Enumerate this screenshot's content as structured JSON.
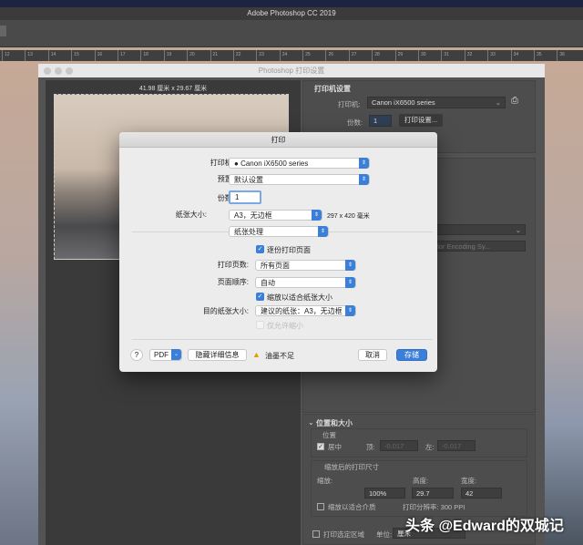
{
  "app": {
    "title": "Adobe Photoshop CC 2019"
  },
  "ruler": [
    "12",
    "13",
    "14",
    "15",
    "16",
    "17",
    "18",
    "19",
    "20",
    "21",
    "22",
    "23",
    "24",
    "25",
    "26",
    "27",
    "28",
    "29",
    "30",
    "31",
    "32",
    "33",
    "34",
    "35",
    "36"
  ],
  "ps_dialog": {
    "title": "Photoshop 打印设置",
    "preview_dims": "41.98 厘米 x 29.67 厘米",
    "printer_settings": {
      "heading": "打印机设置",
      "printer_label": "打印机:",
      "printer_value": "Canon iX6500 series",
      "copies_label": "份数:",
      "copies_value": "1",
      "print_settings_button": "打印设置..."
    },
    "color_profile_value": "...emy Color Encoding Sy...",
    "position_size": {
      "heading": "位置和大小",
      "position_heading": "位置",
      "center_label": "居中",
      "center_checked": true,
      "top_label": "顶:",
      "top_value": "-0.017",
      "left_label": "左:",
      "left_value": "-0.017",
      "scaled_heading": "缩放后的打印尺寸",
      "scale_label": "缩放:",
      "scale_value": "100%",
      "height_label": "高度:",
      "height_value": "29.7",
      "width_label": "宽度:",
      "width_value": "42",
      "fit_media_label": "缩放以适合介质",
      "fit_media_checked": false,
      "resolution_text": "打印分辨率: 300 PPI",
      "print_selection_label": "打印选定区域",
      "print_selection_checked": false,
      "unit_label": "单位:",
      "unit_value": "厘米"
    }
  },
  "mac_dialog": {
    "title": "打印",
    "printer_label": "打印机:",
    "printer_value": "Canon iX6500 series",
    "preset_label": "预置:",
    "preset_value": "默认设置",
    "copies_label": "份数:",
    "copies_value": "1",
    "paper_size_label": "纸张大小:",
    "paper_size_value": "A3，无边框",
    "paper_dims": "297 x 420 毫米",
    "section_value": "纸张处理",
    "collate_label": "逐份打印页面",
    "collate_checked": true,
    "pages_label": "打印页数:",
    "pages_value": "所有页面",
    "order_label": "页面顺序:",
    "order_value": "自动",
    "scale_fit_label": "缩放以适合纸张大小",
    "scale_fit_checked": true,
    "dest_paper_label": "目的纸张大小:",
    "dest_paper_value": "建议的纸张：A3，无边框",
    "scale_down_label": "仅允许缩小",
    "scale_down_checked": false,
    "help": "?",
    "pdf": "PDF",
    "hide_details": "隐藏详细信息",
    "warning": "油墨不足",
    "cancel": "取消",
    "save": "存储"
  },
  "watermark": "头条 @Edward的双城记"
}
